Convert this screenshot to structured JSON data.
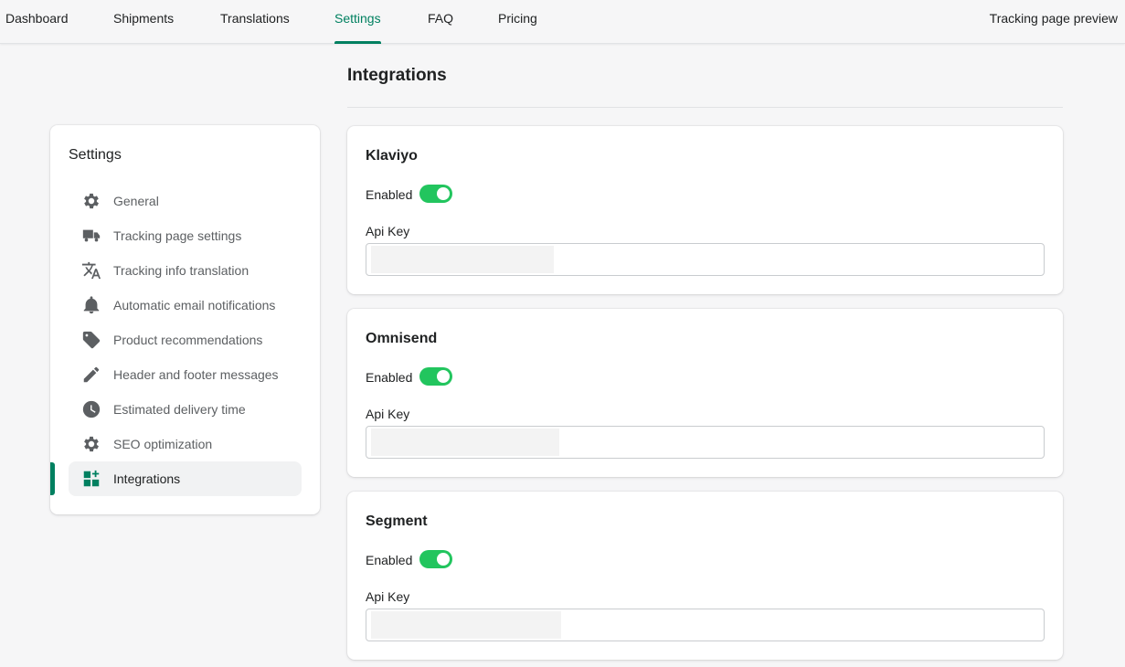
{
  "topnav": {
    "tabs": [
      {
        "label": "Dashboard",
        "active": false
      },
      {
        "label": "Shipments",
        "active": false
      },
      {
        "label": "Translations",
        "active": false
      },
      {
        "label": "Settings",
        "active": true
      },
      {
        "label": "FAQ",
        "active": false
      },
      {
        "label": "Pricing",
        "active": false
      }
    ],
    "preview_label": "Tracking page preview"
  },
  "page": {
    "title": "Integrations"
  },
  "sidebar": {
    "title": "Settings",
    "items": [
      {
        "label": "General",
        "icon": "gear-icon",
        "active": false
      },
      {
        "label": "Tracking page settings",
        "icon": "truck-icon",
        "active": false
      },
      {
        "label": "Tracking info translation",
        "icon": "translate-icon",
        "active": false
      },
      {
        "label": "Automatic email notifications",
        "icon": "bell-icon",
        "active": false
      },
      {
        "label": "Product recommendations",
        "icon": "tag-icon",
        "active": false
      },
      {
        "label": "Header and footer messages",
        "icon": "pencil-icon",
        "active": false
      },
      {
        "label": "Estimated delivery time",
        "icon": "clock-icon",
        "active": false
      },
      {
        "label": "SEO optimization",
        "icon": "gear-icon",
        "active": false
      },
      {
        "label": "Integrations",
        "icon": "apps-icon",
        "active": true
      }
    ]
  },
  "integrations": [
    {
      "name": "Klaviyo",
      "enabled_label": "Enabled",
      "enabled": true,
      "api_key_label": "Api Key",
      "api_key_value": ""
    },
    {
      "name": "Omnisend",
      "enabled_label": "Enabled",
      "enabled": true,
      "api_key_label": "Api Key",
      "api_key_value": ""
    },
    {
      "name": "Segment",
      "enabled_label": "Enabled",
      "enabled": true,
      "api_key_label": "Api Key",
      "api_key_value": ""
    }
  ],
  "colors": {
    "accent": "#008060",
    "toggle_on": "#22c55e",
    "background": "#f6f6f7"
  }
}
